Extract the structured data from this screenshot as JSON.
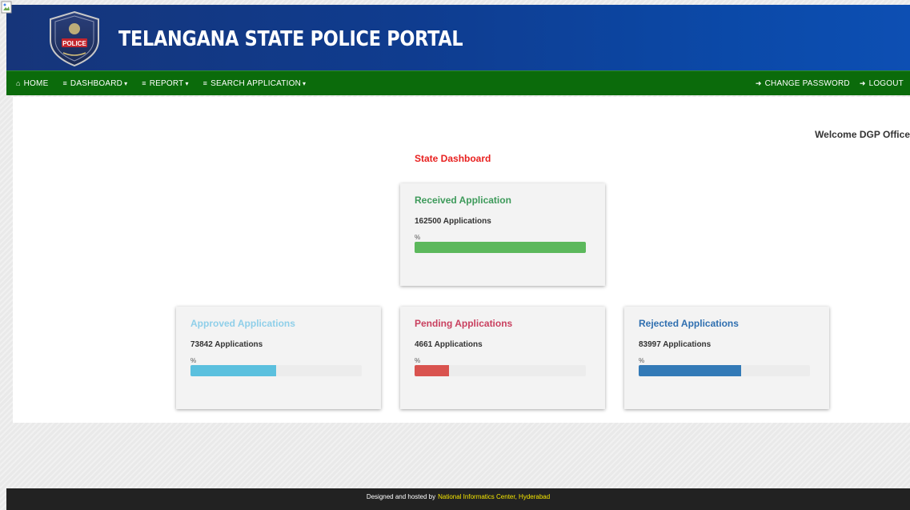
{
  "header": {
    "title": "TELANGANA STATE POLICE PORTAL",
    "logo_text": "POLICE",
    "logo_icon": "police-badge-icon"
  },
  "nav": {
    "left": [
      {
        "label": "HOME",
        "icon": "home-icon",
        "dropdown": false
      },
      {
        "label": "DASHBOARD",
        "icon": "list-icon",
        "dropdown": true
      },
      {
        "label": "REPORT",
        "icon": "list-icon",
        "dropdown": true
      },
      {
        "label": "SEARCH APPLICATION",
        "icon": "list-icon",
        "dropdown": true
      }
    ],
    "right": [
      {
        "label": "CHANGE PASSWORD",
        "icon": "sign-in-icon"
      },
      {
        "label": "LOGOUT",
        "icon": "sign-in-icon"
      }
    ]
  },
  "welcome": "Welcome DGP Office",
  "dashboard": {
    "title": "State Dashboard",
    "pct_symbol": "%",
    "cards": [
      {
        "title": "Received Application",
        "count": "162500 Applications",
        "fill": 1.0,
        "color": "#5cb85c",
        "title_color": "#3d9a5a"
      },
      {
        "title": "Approved Applications",
        "count": "73842 Applications",
        "fill": 0.5,
        "color": "#5bc0de",
        "title_color": "#8fcfe9"
      },
      {
        "title": "Pending Applications",
        "count": "4661 Applications",
        "fill": 0.2,
        "color": "#d9534f",
        "title_color": "#c9405f"
      },
      {
        "title": "Rejected Applications",
        "count": "83997 Applications",
        "fill": 0.6,
        "color": "#337ab7",
        "title_color": "#2f6fb0"
      }
    ]
  },
  "footer": {
    "text": "Designed and hosted by",
    "link": "National Informatics Center, Hyderabad"
  },
  "colors": {
    "header_bg": "#0f3c8f",
    "nav_bg": "#0b6b0b",
    "footer_bg": "#222222",
    "dashboard_title": "#e8201f"
  }
}
